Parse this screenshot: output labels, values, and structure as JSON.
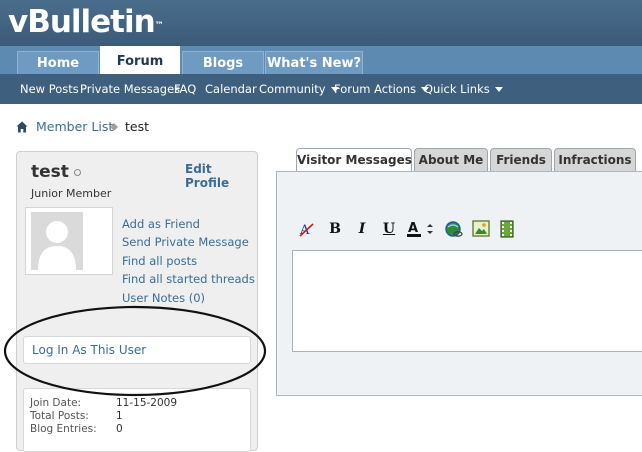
{
  "brand": {
    "logo_text": "vBulletin",
    "logo_mark": "™"
  },
  "tabs": [
    {
      "label": "Home",
      "active": false
    },
    {
      "label": "Forum",
      "active": true
    },
    {
      "label": "Blogs",
      "active": false
    },
    {
      "label": "What's New?",
      "active": false
    }
  ],
  "subnav": [
    {
      "label": "New Posts",
      "dropdown": false
    },
    {
      "label": "Private Messages",
      "dropdown": false
    },
    {
      "label": "FAQ",
      "dropdown": false
    },
    {
      "label": "Calendar",
      "dropdown": false
    },
    {
      "label": "Community",
      "dropdown": true
    },
    {
      "label": "Forum Actions",
      "dropdown": true
    },
    {
      "label": "Quick Links",
      "dropdown": true
    }
  ],
  "breadcrumb": {
    "link": "Member List",
    "current": "test"
  },
  "profile": {
    "username": "test",
    "edit_label": "Edit Profile",
    "user_title": "Junior Member",
    "links": [
      "Add as Friend",
      "Send Private Message",
      "Find all posts",
      "Find all started threads",
      "User Notes (0)"
    ],
    "login_as": "Log In As This User",
    "stats": [
      {
        "label": "Join Date:",
        "value": "11-15-2009"
      },
      {
        "label": "Total Posts:",
        "value": "1"
      },
      {
        "label": "Blog Entries:",
        "value": "0"
      }
    ]
  },
  "content_tabs": [
    {
      "label": "Visitor Messages",
      "active": true
    },
    {
      "label": "About Me",
      "active": false
    },
    {
      "label": "Friends",
      "active": false
    },
    {
      "label": "Infractions",
      "active": false
    }
  ],
  "editor": {
    "buttons": [
      {
        "glyph": "A",
        "icon": "remove-format-icon"
      },
      {
        "glyph": "B",
        "icon": "bold-icon"
      },
      {
        "glyph": "I",
        "icon": "italic-icon"
      },
      {
        "glyph": "U",
        "icon": "underline-icon"
      },
      {
        "glyph": "A",
        "icon": "font-color-icon"
      },
      {
        "glyph": "",
        "icon": "insert-link-icon"
      },
      {
        "glyph": "",
        "icon": "insert-image-icon"
      },
      {
        "glyph": "",
        "icon": "insert-video-icon"
      }
    ],
    "content": ""
  },
  "colors": {
    "header": "#3f5f7e",
    "tabbar": "#5d8ab0",
    "link": "#3b6c94"
  }
}
